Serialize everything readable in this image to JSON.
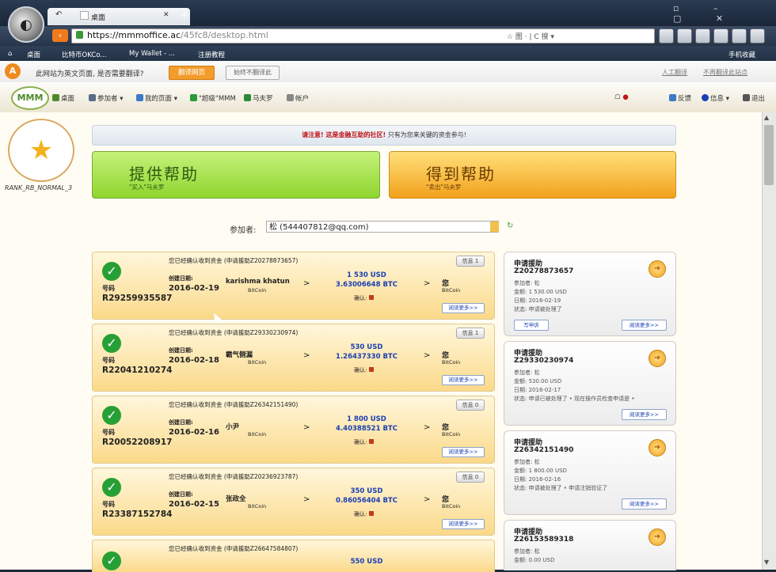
{
  "browser": {
    "tab_title": "桌面",
    "tab_close": "✕",
    "tab_new": "+",
    "url_host": "https://mmmoffice.ac",
    "url_path": "/45fc8/desktop.html",
    "url_right": "☆ 图 · | C 搜 ▾",
    "window_controls": "▫ – ▢ ✕",
    "bookmarks": [
      "桌面",
      "比特币OKCo...",
      "My Wallet - ...",
      "注册教程",
      "手机收藏"
    ]
  },
  "notice": {
    "text": "此网站为英文页面, 是否需要翻译?",
    "translate_label": "翻译网页",
    "never_label": "始终不翻译此",
    "right1": "人工翻译",
    "right2": "不再翻译此站点"
  },
  "site_menu": [
    {
      "label": "桌面",
      "color": "#4d8b2a"
    },
    {
      "label": "参加者 ▾",
      "color": "#5a6a8a"
    },
    {
      "label": "我的页面 ▾",
      "color": "#3a7ac8"
    },
    {
      "label": "\"超级\"MMM",
      "color": "#2a9a3a"
    },
    {
      "label": "马夫罗",
      "color": "#2a8a3a"
    },
    {
      "label": "帐户",
      "color": "#888"
    }
  ],
  "site_menu_right": [
    {
      "label": "●",
      "color": "#c0141a"
    },
    {
      "label": "反馈",
      "color": "#3a7ac8"
    },
    {
      "label": "信息 ▾",
      "color": "#1a3fb4"
    },
    {
      "label": "退出",
      "color": "#555"
    }
  ],
  "user": {
    "rank": "RANK_RB_NORMAL_3",
    "alert_red": "请注意! 这是金融互助的社区!",
    "alert_black": "只有为您来关键的资金参与!"
  },
  "actions": {
    "provide_title": "提供帮助",
    "provide_sub": "\"买入\"马夫罗",
    "get_title": "得到帮助",
    "get_sub": "\"卖出\"马夫罗"
  },
  "participant": {
    "label": "参加者:",
    "value": "松 (544407812@qq.com)"
  },
  "cards": [
    {
      "title": "您已经确认收到资金 (申请援助Z20278873657)",
      "badge": "信息 1",
      "id_label": "号码",
      "id": "R29259935587",
      "date_label": "创建日期:",
      "date": "2016-02-19",
      "from": "karishma khatun",
      "from_sub": "BitCoin",
      "usd": "1 530 USD",
      "btc": "3.63006648 BTC",
      "to": "您",
      "to_sub": "BitCoin",
      "confirm": "确认:",
      "more": "阅读更多>>"
    },
    {
      "title": "您已经确认收到资金 (申请援助Z29330230974)",
      "badge": "信息 1",
      "id_label": "号码",
      "id": "R22041210274",
      "date_label": "创建日期:",
      "date": "2016-02-18",
      "from": "霸气侧漏",
      "from_sub": "BitCoin",
      "usd": "530 USD",
      "btc": "1.26437330 BTC",
      "to": "您",
      "to_sub": "BitCoin",
      "confirm": "确认:",
      "more": "阅读更多>>"
    },
    {
      "title": "您已经确认收到资金 (申请援助Z26342151490)",
      "badge": "信息 0",
      "id_label": "号码",
      "id": "R20052208917",
      "date_label": "创建日期:",
      "date": "2016-02-16",
      "from": "小尹",
      "from_sub": "BitCoin",
      "usd": "1 800 USD",
      "btc": "4.40388521 BTC",
      "to": "您",
      "to_sub": "BitCoin",
      "confirm": "确认:",
      "more": "阅读更多>>"
    },
    {
      "title": "您已经确认收到资金 (申请援助Z20236923787)",
      "badge": "信息 0",
      "id_label": "号码",
      "id": "R23387152784",
      "date_label": "创建日期:",
      "date": "2016-02-15",
      "from": "张政全",
      "from_sub": "BitCoin",
      "usd": "350 USD",
      "btc": "0.86056404 BTC",
      "to": "您",
      "to_sub": "BitCoin",
      "confirm": "确认:",
      "more": "阅读更多>>"
    },
    {
      "title": "您已经确认收到资金 (申请援助Z26647584807)",
      "badge": "",
      "id_label": "",
      "id": "",
      "date_label": "",
      "date": "",
      "from": "",
      "from_sub": "",
      "usd": "550 USD",
      "btc": "",
      "to": "",
      "to_sub": "",
      "confirm": "",
      "more": ""
    }
  ],
  "requests": [
    {
      "title": "申请援助",
      "id": "Z20278873657",
      "l1": "参加者: 松",
      "l2": "金额: 1 530.00 USD",
      "l3": "日期: 2016-02-19",
      "l4": "状态: 申请被处理了",
      "write": "写申诉",
      "more": "阅读更多>>"
    },
    {
      "title": "申请援助",
      "id": "Z29330230974",
      "l1": "参加者: 松",
      "l2": "金额: 530.00 USD",
      "l3": "日期: 2016-02-17",
      "l4": "状态: 申请已被处理了 • 现在操作员检查申请是 •",
      "write": "",
      "more": "阅读更多>>"
    },
    {
      "title": "申请援助",
      "id": "Z26342151490",
      "l1": "参加者: 松",
      "l2": "金额: 1 800.00 USD",
      "l3": "日期: 2016-02-16",
      "l4": "状态: 申请被处理了 • 申请注销验证了",
      "write": "",
      "more": "阅读更多>>"
    },
    {
      "title": "申请援助",
      "id": "Z26153589318",
      "l1": "参加者: 松",
      "l2": "金额: 0.00 USD",
      "l3": "",
      "l4": "",
      "write": "",
      "more": ""
    }
  ]
}
